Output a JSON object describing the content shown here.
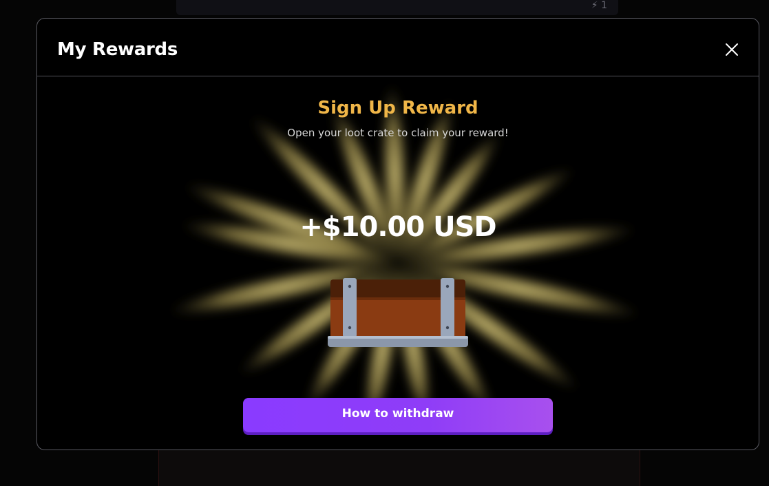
{
  "background": {
    "badge_text": "1"
  },
  "modal": {
    "title": "My Rewards",
    "close_icon": "close-icon"
  },
  "reward": {
    "title": "Sign Up Reward",
    "subtitle": "Open your loot crate to claim your reward!",
    "amount": "+$10.00 USD",
    "image": "loot-crate"
  },
  "actions": {
    "withdraw_label": "How to withdraw"
  },
  "colors": {
    "title_gold": "#f0b648",
    "button_purple": "#8a3bff",
    "ray_gold": "#e8d57a"
  }
}
